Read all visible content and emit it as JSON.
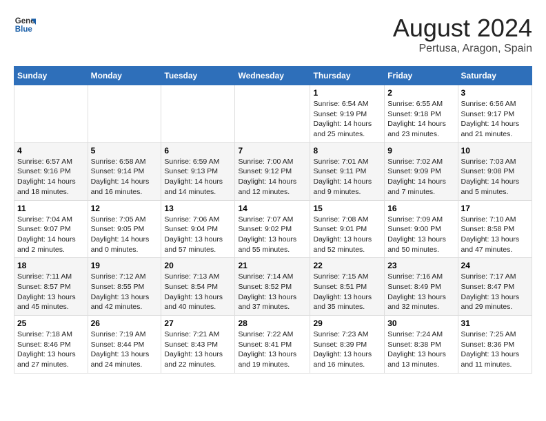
{
  "header": {
    "logo_general": "General",
    "logo_blue": "Blue",
    "title": "August 2024",
    "subtitle": "Pertusa, Aragon, Spain"
  },
  "days_of_week": [
    "Sunday",
    "Monday",
    "Tuesday",
    "Wednesday",
    "Thursday",
    "Friday",
    "Saturday"
  ],
  "weeks": [
    [
      {
        "day": "",
        "info": ""
      },
      {
        "day": "",
        "info": ""
      },
      {
        "day": "",
        "info": ""
      },
      {
        "day": "",
        "info": ""
      },
      {
        "day": "1",
        "info": "Sunrise: 6:54 AM\nSunset: 9:19 PM\nDaylight: 14 hours\nand 25 minutes."
      },
      {
        "day": "2",
        "info": "Sunrise: 6:55 AM\nSunset: 9:18 PM\nDaylight: 14 hours\nand 23 minutes."
      },
      {
        "day": "3",
        "info": "Sunrise: 6:56 AM\nSunset: 9:17 PM\nDaylight: 14 hours\nand 21 minutes."
      }
    ],
    [
      {
        "day": "4",
        "info": "Sunrise: 6:57 AM\nSunset: 9:16 PM\nDaylight: 14 hours\nand 18 minutes."
      },
      {
        "day": "5",
        "info": "Sunrise: 6:58 AM\nSunset: 9:14 PM\nDaylight: 14 hours\nand 16 minutes."
      },
      {
        "day": "6",
        "info": "Sunrise: 6:59 AM\nSunset: 9:13 PM\nDaylight: 14 hours\nand 14 minutes."
      },
      {
        "day": "7",
        "info": "Sunrise: 7:00 AM\nSunset: 9:12 PM\nDaylight: 14 hours\nand 12 minutes."
      },
      {
        "day": "8",
        "info": "Sunrise: 7:01 AM\nSunset: 9:11 PM\nDaylight: 14 hours\nand 9 minutes."
      },
      {
        "day": "9",
        "info": "Sunrise: 7:02 AM\nSunset: 9:09 PM\nDaylight: 14 hours\nand 7 minutes."
      },
      {
        "day": "10",
        "info": "Sunrise: 7:03 AM\nSunset: 9:08 PM\nDaylight: 14 hours\nand 5 minutes."
      }
    ],
    [
      {
        "day": "11",
        "info": "Sunrise: 7:04 AM\nSunset: 9:07 PM\nDaylight: 14 hours\nand 2 minutes."
      },
      {
        "day": "12",
        "info": "Sunrise: 7:05 AM\nSunset: 9:05 PM\nDaylight: 14 hours\nand 0 minutes."
      },
      {
        "day": "13",
        "info": "Sunrise: 7:06 AM\nSunset: 9:04 PM\nDaylight: 13 hours\nand 57 minutes."
      },
      {
        "day": "14",
        "info": "Sunrise: 7:07 AM\nSunset: 9:02 PM\nDaylight: 13 hours\nand 55 minutes."
      },
      {
        "day": "15",
        "info": "Sunrise: 7:08 AM\nSunset: 9:01 PM\nDaylight: 13 hours\nand 52 minutes."
      },
      {
        "day": "16",
        "info": "Sunrise: 7:09 AM\nSunset: 9:00 PM\nDaylight: 13 hours\nand 50 minutes."
      },
      {
        "day": "17",
        "info": "Sunrise: 7:10 AM\nSunset: 8:58 PM\nDaylight: 13 hours\nand 47 minutes."
      }
    ],
    [
      {
        "day": "18",
        "info": "Sunrise: 7:11 AM\nSunset: 8:57 PM\nDaylight: 13 hours\nand 45 minutes."
      },
      {
        "day": "19",
        "info": "Sunrise: 7:12 AM\nSunset: 8:55 PM\nDaylight: 13 hours\nand 42 minutes."
      },
      {
        "day": "20",
        "info": "Sunrise: 7:13 AM\nSunset: 8:54 PM\nDaylight: 13 hours\nand 40 minutes."
      },
      {
        "day": "21",
        "info": "Sunrise: 7:14 AM\nSunset: 8:52 PM\nDaylight: 13 hours\nand 37 minutes."
      },
      {
        "day": "22",
        "info": "Sunrise: 7:15 AM\nSunset: 8:51 PM\nDaylight: 13 hours\nand 35 minutes."
      },
      {
        "day": "23",
        "info": "Sunrise: 7:16 AM\nSunset: 8:49 PM\nDaylight: 13 hours\nand 32 minutes."
      },
      {
        "day": "24",
        "info": "Sunrise: 7:17 AM\nSunset: 8:47 PM\nDaylight: 13 hours\nand 29 minutes."
      }
    ],
    [
      {
        "day": "25",
        "info": "Sunrise: 7:18 AM\nSunset: 8:46 PM\nDaylight: 13 hours\nand 27 minutes."
      },
      {
        "day": "26",
        "info": "Sunrise: 7:19 AM\nSunset: 8:44 PM\nDaylight: 13 hours\nand 24 minutes."
      },
      {
        "day": "27",
        "info": "Sunrise: 7:21 AM\nSunset: 8:43 PM\nDaylight: 13 hours\nand 22 minutes."
      },
      {
        "day": "28",
        "info": "Sunrise: 7:22 AM\nSunset: 8:41 PM\nDaylight: 13 hours\nand 19 minutes."
      },
      {
        "day": "29",
        "info": "Sunrise: 7:23 AM\nSunset: 8:39 PM\nDaylight: 13 hours\nand 16 minutes."
      },
      {
        "day": "30",
        "info": "Sunrise: 7:24 AM\nSunset: 8:38 PM\nDaylight: 13 hours\nand 13 minutes."
      },
      {
        "day": "31",
        "info": "Sunrise: 7:25 AM\nSunset: 8:36 PM\nDaylight: 13 hours\nand 11 minutes."
      }
    ]
  ]
}
